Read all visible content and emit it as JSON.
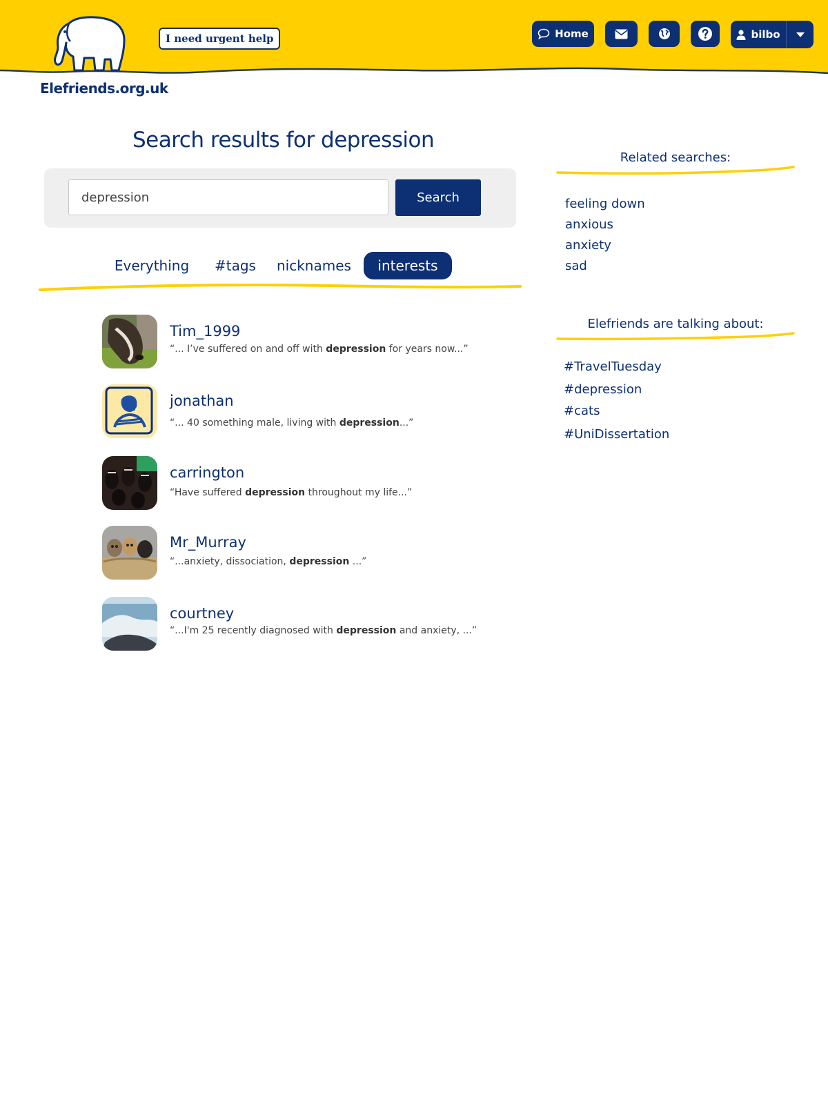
{
  "header": {
    "site_name": "Elefriends.org.uk",
    "urgent_help_label": "I need urgent help",
    "nav": {
      "home_label": "Home",
      "user_label": "bilbo"
    },
    "colors": {
      "header_bg": "#ffcf00",
      "navy": "#0d2f74"
    }
  },
  "search": {
    "title": "Search results for depression",
    "query": "depression",
    "button_label": "Search"
  },
  "tabs": [
    {
      "label": "Everything",
      "active": false
    },
    {
      "label": "#tags",
      "active": false
    },
    {
      "label": "nicknames",
      "active": false
    },
    {
      "label": "interests",
      "active": true
    }
  ],
  "results": [
    {
      "nickname": "Tim_1999",
      "pre": "“... I’ve suffered on and off with ",
      "highlight": "depression",
      "post": " for years now...”",
      "avatar": "dog-photo"
    },
    {
      "nickname": "jonathan",
      "pre": "“... 40 something male, living with ",
      "highlight": "depression",
      "post": "...”",
      "avatar": "scribble-portrait"
    },
    {
      "nickname": "carrington",
      "pre": "“Have suffered ",
      "highlight": "depression",
      "post": " throughout my life...”",
      "avatar": "knobs-photo"
    },
    {
      "nickname": "Mr_Murray",
      "pre": "“...anxiety, dissociation, ",
      "highlight": "depression",
      "post": " ...”",
      "avatar": "kittens-photo"
    },
    {
      "nickname": "courtney",
      "pre": "“...I'm 25 recently diagnosed with ",
      "highlight": "depression",
      "post": " and anxiety, ...”",
      "avatar": "sea-photo"
    }
  ],
  "sidebar": {
    "related_title": "Related searches:",
    "related": [
      "feeling down",
      "anxious",
      "anxiety",
      "sad"
    ],
    "talking_title": "Elefriends are talking about:",
    "tags": [
      "#TravelTuesday",
      "#depression",
      "#cats",
      "#UniDissertation"
    ]
  }
}
